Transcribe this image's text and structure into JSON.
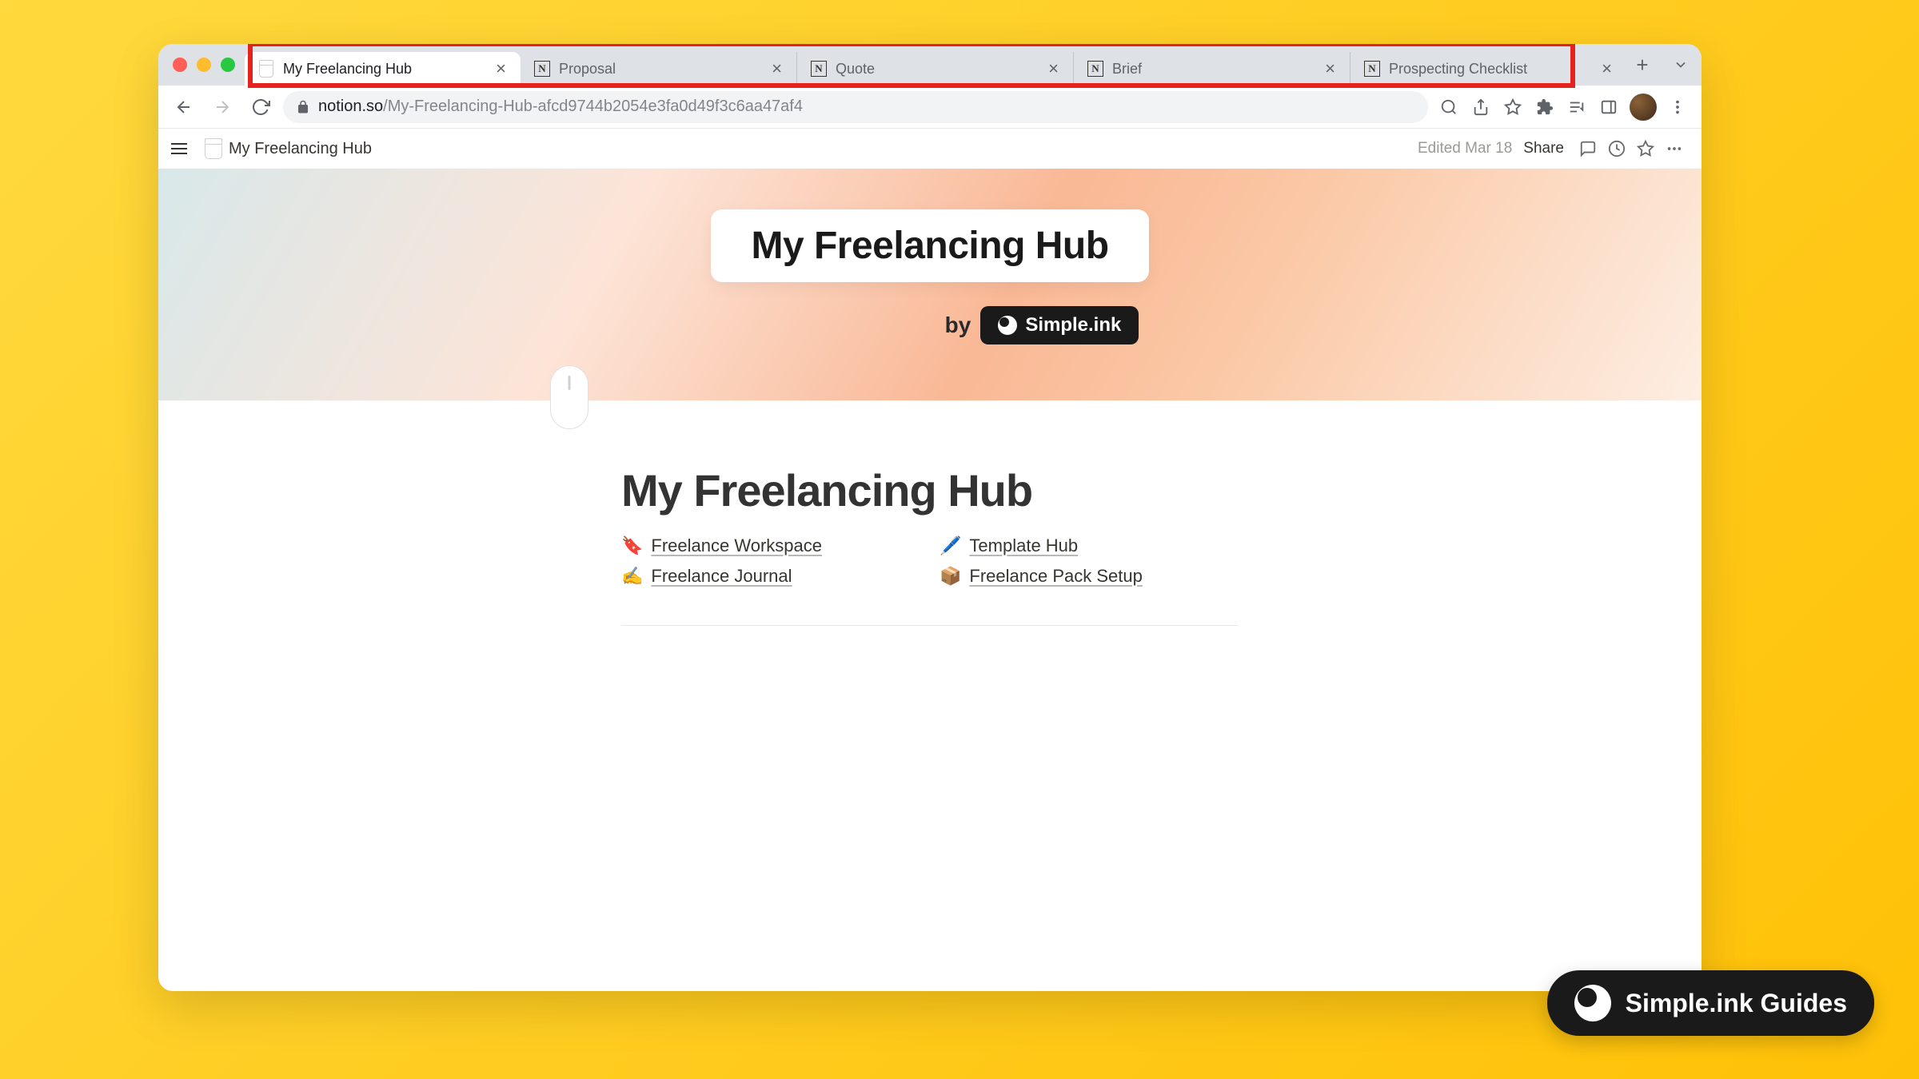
{
  "tabs": [
    {
      "title": "My Freelancing Hub",
      "active": true,
      "icon_type": "page"
    },
    {
      "title": "Proposal",
      "active": false,
      "icon_type": "notion"
    },
    {
      "title": "Quote",
      "active": false,
      "icon_type": "notion"
    },
    {
      "title": "Brief",
      "active": false,
      "icon_type": "notion"
    },
    {
      "title": "Prospecting Checklist",
      "active": false,
      "icon_type": "notion"
    }
  ],
  "url": {
    "domain": "notion.so",
    "path": "/My-Freelancing-Hub-afcd9744b2054e3fa0d49f3c6aa47af4"
  },
  "notion": {
    "breadcrumb": "My Freelancing Hub",
    "edited": "Edited Mar 18",
    "share": "Share",
    "cover_title": "My Freelancing Hub",
    "by_label": "by",
    "simple_badge": "Simple.ink",
    "page_title": "My Freelancing Hub",
    "links": [
      {
        "emoji": "🔖",
        "label": "Freelance Workspace"
      },
      {
        "emoji": "🖊️",
        "label": "Template Hub"
      },
      {
        "emoji": "✍️",
        "label": "Freelance Journal"
      },
      {
        "emoji": "📦",
        "label": "Freelance Pack Setup"
      }
    ]
  },
  "guides_badge": "Simple.ink Guides"
}
